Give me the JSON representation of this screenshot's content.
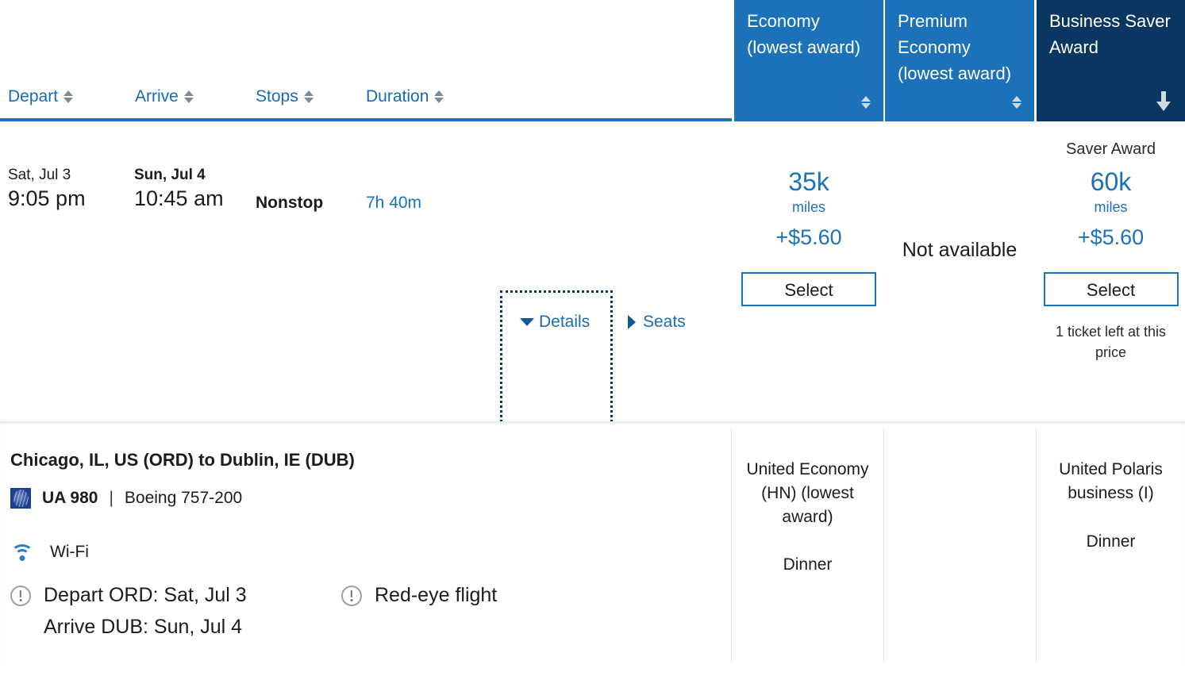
{
  "header": {
    "sort_columns": [
      {
        "label": "Depart",
        "icon": "sort-updown-icon"
      },
      {
        "label": "Arrive",
        "icon": "sort-updown-icon"
      },
      {
        "label": "Stops",
        "icon": "sort-updown-icon"
      },
      {
        "label": "Duration",
        "icon": "sort-updown-icon"
      }
    ],
    "fare_columns": [
      {
        "title": "Economy (lowest award)",
        "sort_icon": "sort-updown-icon",
        "selected": false,
        "bg": "#1b72b8"
      },
      {
        "title": "Premium Economy (lowest award)",
        "sort_icon": "sort-updown-icon",
        "selected": false,
        "bg": "#1b72b8"
      },
      {
        "title": "Business Saver Award",
        "sort_icon": "sort-down-arrow-icon",
        "selected": true,
        "bg": "#0a3761"
      }
    ]
  },
  "flight": {
    "depart": {
      "day": "Sat, Jul 3",
      "time": "9:05 pm"
    },
    "arrive": {
      "day": "Sun, Jul 4",
      "time": "10:45 am"
    },
    "stops": "Nonstop",
    "duration": "7h 40m",
    "details_label": "Details",
    "seats_label": "Seats"
  },
  "fares": {
    "economy": {
      "award_label": "",
      "miles": "35k",
      "miles_unit": "miles",
      "tax": "+$5.60",
      "select_label": "Select",
      "note": ""
    },
    "premium_economy": {
      "unavailable_label": "Not available"
    },
    "business": {
      "award_label": "Saver Award",
      "miles": "60k",
      "miles_unit": "miles",
      "tax": "+$5.60",
      "select_label": "Select",
      "note": "1 ticket left at this price"
    }
  },
  "details_panel": {
    "route_title": "Chicago, IL, US (ORD) to Dublin, IE (DUB)",
    "airline_logo": "united-globe-logo",
    "flight_number": "UA 980",
    "separator": "|",
    "aircraft": "Boeing 757-200",
    "amenities": [
      {
        "icon": "wifi-icon",
        "label": "Wi-Fi"
      }
    ],
    "notices": [
      {
        "icon": "info-circle-icon",
        "line1": "Depart ORD: Sat, Jul 3",
        "line2": "Arrive DUB: Sun, Jul 4"
      },
      {
        "icon": "info-circle-icon",
        "line1": "Red-eye flight",
        "line2": ""
      }
    ],
    "cabins": [
      {
        "name": "United Economy (HN) (lowest award)",
        "meal": "Dinner"
      },
      {
        "name": "",
        "meal": ""
      },
      {
        "name": "United Polaris business (I)",
        "meal": "Dinner"
      }
    ]
  },
  "colors": {
    "brand_blue": "#1b72b8",
    "selected_navy": "#0a3761",
    "link_blue": "#176ab4",
    "text_dark": "#1c1c1c"
  }
}
